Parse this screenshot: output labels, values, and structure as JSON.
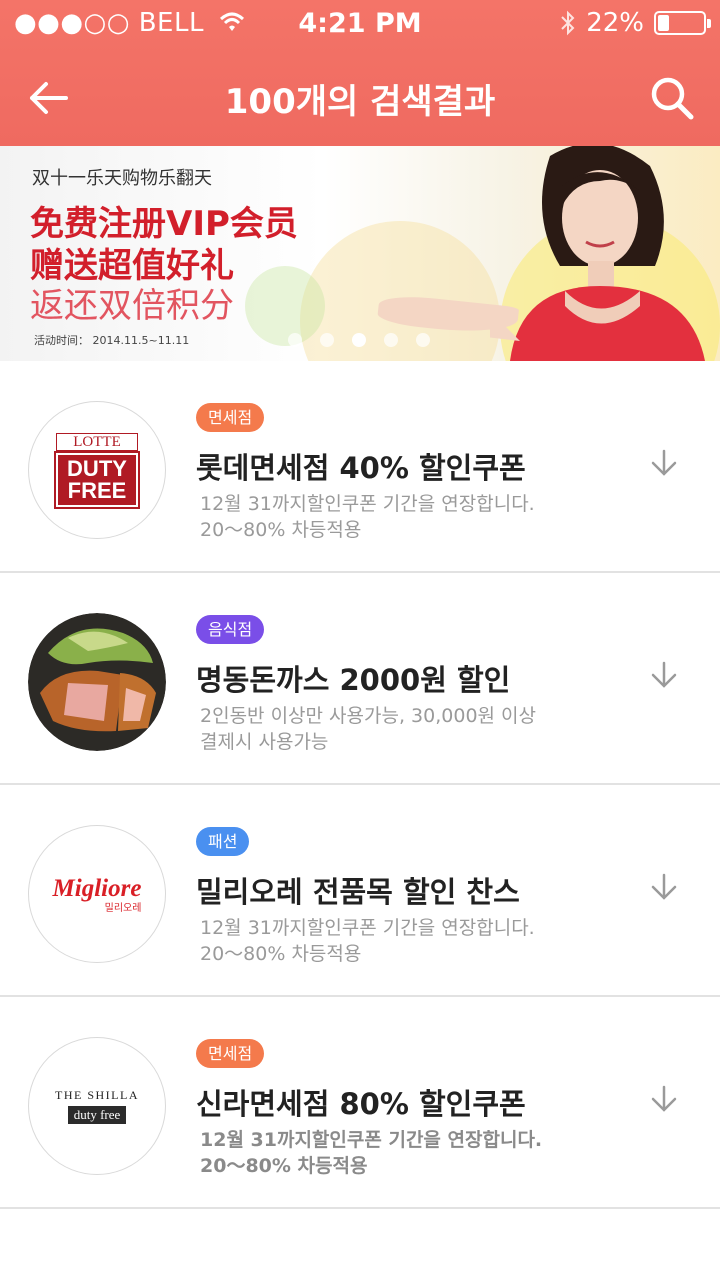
{
  "status_bar": {
    "carrier": "●●●○○ BELL",
    "time": "4:21 PM",
    "battery": "22%",
    "battery_level": 0.22
  },
  "nav": {
    "title": "100개의 검색결과"
  },
  "banner": {
    "subtitle": "双十一乐天购物乐翻天",
    "line1": "免费注册VIP会员",
    "line2": "赠送超值好礼",
    "line3": "返还双倍积分",
    "date": "活动时间： 2014.11.5~11.11",
    "page_count": 5,
    "active_page": 3
  },
  "coupons": [
    {
      "category": "면세점",
      "category_color": "#f47a4c",
      "title": "롯데면세점 40% 할인쿠폰",
      "desc1": "12월 31까지할인쿠폰 기간을 연장합니다.",
      "desc2": "20～80% 차등적용",
      "logo": {
        "line1": "LOTTE",
        "line2": "DUTY",
        "line3": "FREE"
      }
    },
    {
      "category": "음식점",
      "category_color": "#7a4ee8",
      "title": "명동돈까스 2000원 할인",
      "desc1": "2인동반 이상만 사용가능, 30,000원 이상",
      "desc2": "결제시 사용가능"
    },
    {
      "category": "패션",
      "category_color": "#4a90f0",
      "title": "밀리오레 전품목 할인 찬스",
      "desc1": "12월 31까지할인쿠폰 기간을 연장합니다.",
      "desc2": "20～80% 차등적용",
      "logo": {
        "line1": "Migliore",
        "line2": "밀리오레"
      }
    },
    {
      "category": "면세점",
      "category_color": "#f47a4c",
      "title": "신라면세점 80% 할인쿠폰",
      "desc1": "12월 31까지할인쿠폰 기간을 연장합니다.",
      "desc2": "20～80% 차등적용",
      "logo": {
        "line1": "THE SHILLA",
        "line2": "duty free"
      }
    }
  ]
}
